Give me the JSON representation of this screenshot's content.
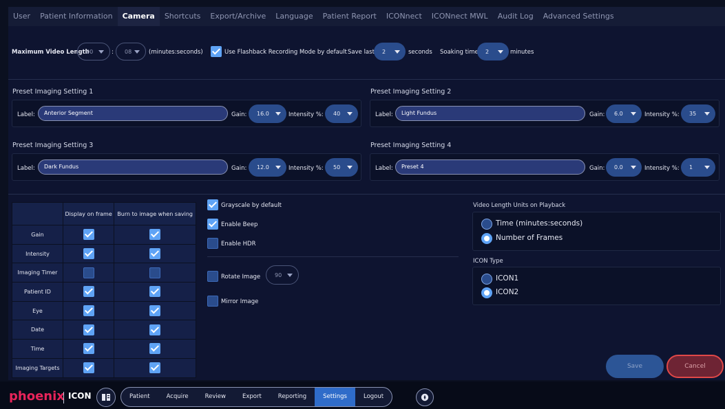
{
  "tabs": [
    {
      "label": "User",
      "active": false
    },
    {
      "label": "Patient Information",
      "active": false
    },
    {
      "label": "Camera",
      "active": true
    },
    {
      "label": "Shortcuts",
      "active": false
    },
    {
      "label": "Export/Archive",
      "active": false
    },
    {
      "label": "Language",
      "active": false
    },
    {
      "label": "Patient Report",
      "active": false
    },
    {
      "label": "ICONnect",
      "active": false
    },
    {
      "label": "ICONnect MWL",
      "active": false
    },
    {
      "label": "Audit Log",
      "active": false
    },
    {
      "label": "Advanced Settings",
      "active": false
    }
  ],
  "video": {
    "max_length_label": "Maximum Video Length",
    "minutes_value": "00",
    "seconds_value": "08",
    "colon": ":",
    "units_label": "(minutes:seconds)",
    "flashback_label": "Use Flashback Recording Mode by default",
    "flashback_checked": true,
    "save_last_label": "Save last",
    "save_last_value": "2",
    "seconds_label": "seconds",
    "soaking_label": "Soaking time",
    "soaking_value": "2",
    "minutes_label": "minutes"
  },
  "presets": [
    {
      "title": "Preset Imaging Setting 1",
      "label_text": "Label:",
      "label_value": "Anterior Segment",
      "gain_label": "Gain:",
      "gain": "16.0",
      "intensity_label": "Intensity %:",
      "intensity": "40"
    },
    {
      "title": "Preset Imaging Setting 2",
      "label_text": "Label:",
      "label_value": "Light Fundus",
      "gain_label": "Gain:",
      "gain": "6.0",
      "intensity_label": "Intensity %:",
      "intensity": "35"
    },
    {
      "title": "Preset Imaging Setting 3",
      "label_text": "Label:",
      "label_value": "Dark Fundus",
      "gain_label": "Gain:",
      "gain": "12.0",
      "intensity_label": "Intensity %:",
      "intensity": "50"
    },
    {
      "title": "Preset Imaging Setting 4",
      "label_text": "Label:",
      "label_value": "Preset 4",
      "gain_label": "Gain:",
      "gain": "0.0",
      "intensity_label": "Intensity %:",
      "intensity": "1"
    }
  ],
  "overlay_table": {
    "headers": [
      "",
      "Display on frame",
      "Burn to image when saving"
    ],
    "rows": [
      {
        "label": "Gain",
        "display": true,
        "burn": true
      },
      {
        "label": "Intensity",
        "display": true,
        "burn": true
      },
      {
        "label": "Imaging Timer",
        "display": false,
        "burn": false
      },
      {
        "label": "Patient ID",
        "display": true,
        "burn": true
      },
      {
        "label": "Eye",
        "display": true,
        "burn": true
      },
      {
        "label": "Date",
        "display": true,
        "burn": true
      },
      {
        "label": "Time",
        "display": true,
        "burn": true
      },
      {
        "label": "Imaging Targets",
        "display": true,
        "burn": true
      }
    ]
  },
  "options": {
    "grayscale": {
      "label": "Grayscale by default",
      "checked": true
    },
    "beep": {
      "label": "Enable Beep",
      "checked": true
    },
    "hdr": {
      "label": "Enable HDR",
      "checked": false
    },
    "rotate": {
      "label": "Rotate Image",
      "checked": false,
      "value": "90"
    },
    "mirror": {
      "label": "Mirror Image",
      "checked": false
    }
  },
  "playback_units": {
    "title": "Video Length Units on Playback",
    "options": [
      {
        "label": "Time (minutes:seconds)",
        "selected": false
      },
      {
        "label": "Number of Frames",
        "selected": true
      }
    ]
  },
  "icon_type": {
    "title": "ICON Type",
    "options": [
      {
        "label": "ICON1",
        "selected": false
      },
      {
        "label": "ICON2",
        "selected": true
      }
    ]
  },
  "buttons": {
    "save": "Save",
    "cancel": "Cancel"
  },
  "brand": {
    "phoenix": "phoenix",
    "icon": "ICON"
  },
  "bottom_nav": [
    {
      "label": "Patient",
      "active": false
    },
    {
      "label": "Acquire",
      "active": false
    },
    {
      "label": "Review",
      "active": false
    },
    {
      "label": "Export",
      "active": false
    },
    {
      "label": "Reporting",
      "active": false
    },
    {
      "label": "Settings",
      "active": true
    },
    {
      "label": "Logout",
      "active": false
    }
  ],
  "colors": {
    "accent": "#5fa3f5",
    "active_nav": "#2f6cc9",
    "brand_red": "#e8245a",
    "cancel_border": "#e04848"
  }
}
